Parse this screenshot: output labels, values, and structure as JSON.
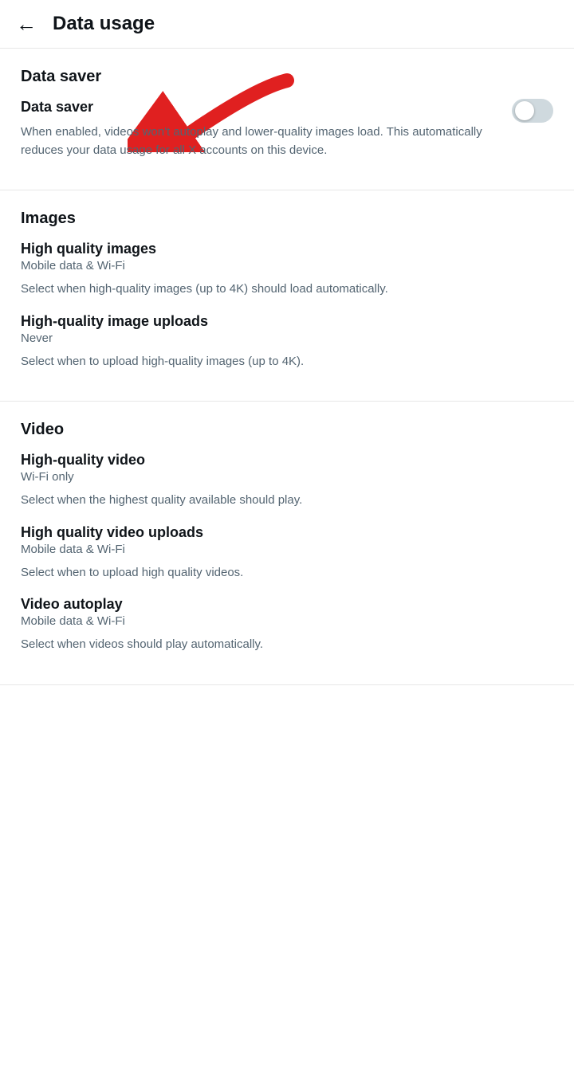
{
  "header": {
    "back_label": "←",
    "title": "Data usage"
  },
  "data_saver_section": {
    "section_title": "Data saver",
    "setting_label": "Data saver",
    "setting_description": "When enabled, videos won't autoplay and lower-quality images load. This automatically reduces your data usage for all X accounts on this device.",
    "toggle_enabled": false
  },
  "images_section": {
    "section_title": "Images",
    "items": [
      {
        "label": "High quality images",
        "value": "Mobile data & Wi-Fi",
        "description": "Select when high-quality images (up to 4K) should load automatically."
      },
      {
        "label": "High-quality image uploads",
        "value": "Never",
        "description": "Select when to upload high-quality images (up to 4K)."
      }
    ]
  },
  "video_section": {
    "section_title": "Video",
    "items": [
      {
        "label": "High-quality video",
        "value": "Wi-Fi only",
        "description": "Select when the highest quality available should play."
      },
      {
        "label": "High quality video uploads",
        "value": "Mobile data & Wi-Fi",
        "description": "Select when to upload high quality videos."
      },
      {
        "label": "Video autoplay",
        "value": "Mobile data & Wi-Fi",
        "description": "Select when videos should play automatically."
      }
    ]
  }
}
